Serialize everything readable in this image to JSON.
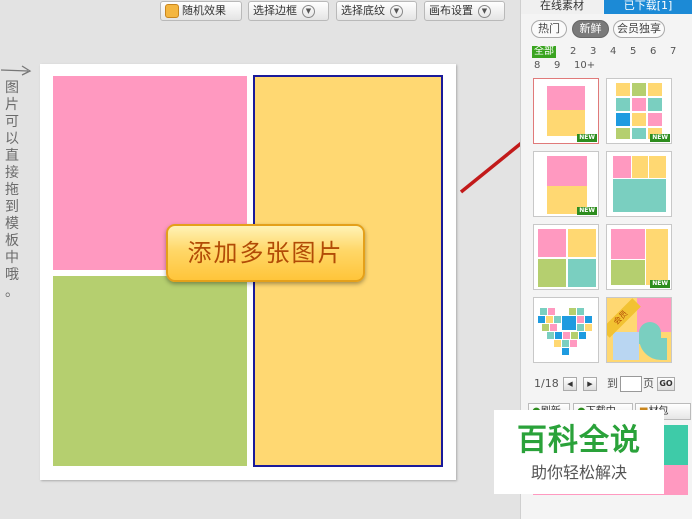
{
  "toolbar": {
    "random_label": "随机效果",
    "border_label": "选择边框",
    "texture_label": "选择底纹",
    "canvas_label": "画布设置"
  },
  "canvas": {
    "button_label": "添加多张图片",
    "colors": {
      "pink": "#ff99c0",
      "yellow": "#ffd872",
      "green": "#b5cf6f",
      "selection": "#1a1a9a"
    }
  },
  "hint": {
    "chars": [
      "图",
      "片",
      "可",
      "以",
      "直",
      "接",
      "拖",
      "到",
      "模",
      "板",
      "中",
      "哦",
      "。"
    ]
  },
  "panel": {
    "tab_online": "在线素材",
    "tab_downloaded": "已下载[1]",
    "chips": [
      "热门",
      "新鲜",
      "会员独享"
    ],
    "count_filters": [
      "全部",
      "2",
      "3",
      "4",
      "5",
      "6",
      "7",
      "8",
      "9",
      "10+"
    ],
    "new_badge": "NEW",
    "vip_badge": "会员",
    "pager": {
      "status": "1/18",
      "goto_label": "到",
      "page_label": "页",
      "go_label": "GO"
    },
    "bottom_buttons": [
      "刷新",
      "下载中",
      "材包"
    ],
    "colors": {
      "tab_active": "#1c8ad6",
      "chip_active": "#7a7a7a",
      "filter_active": "#3aa420"
    }
  },
  "watermark": {
    "title": "百科全说",
    "subtitle": "助你轻松解决"
  }
}
